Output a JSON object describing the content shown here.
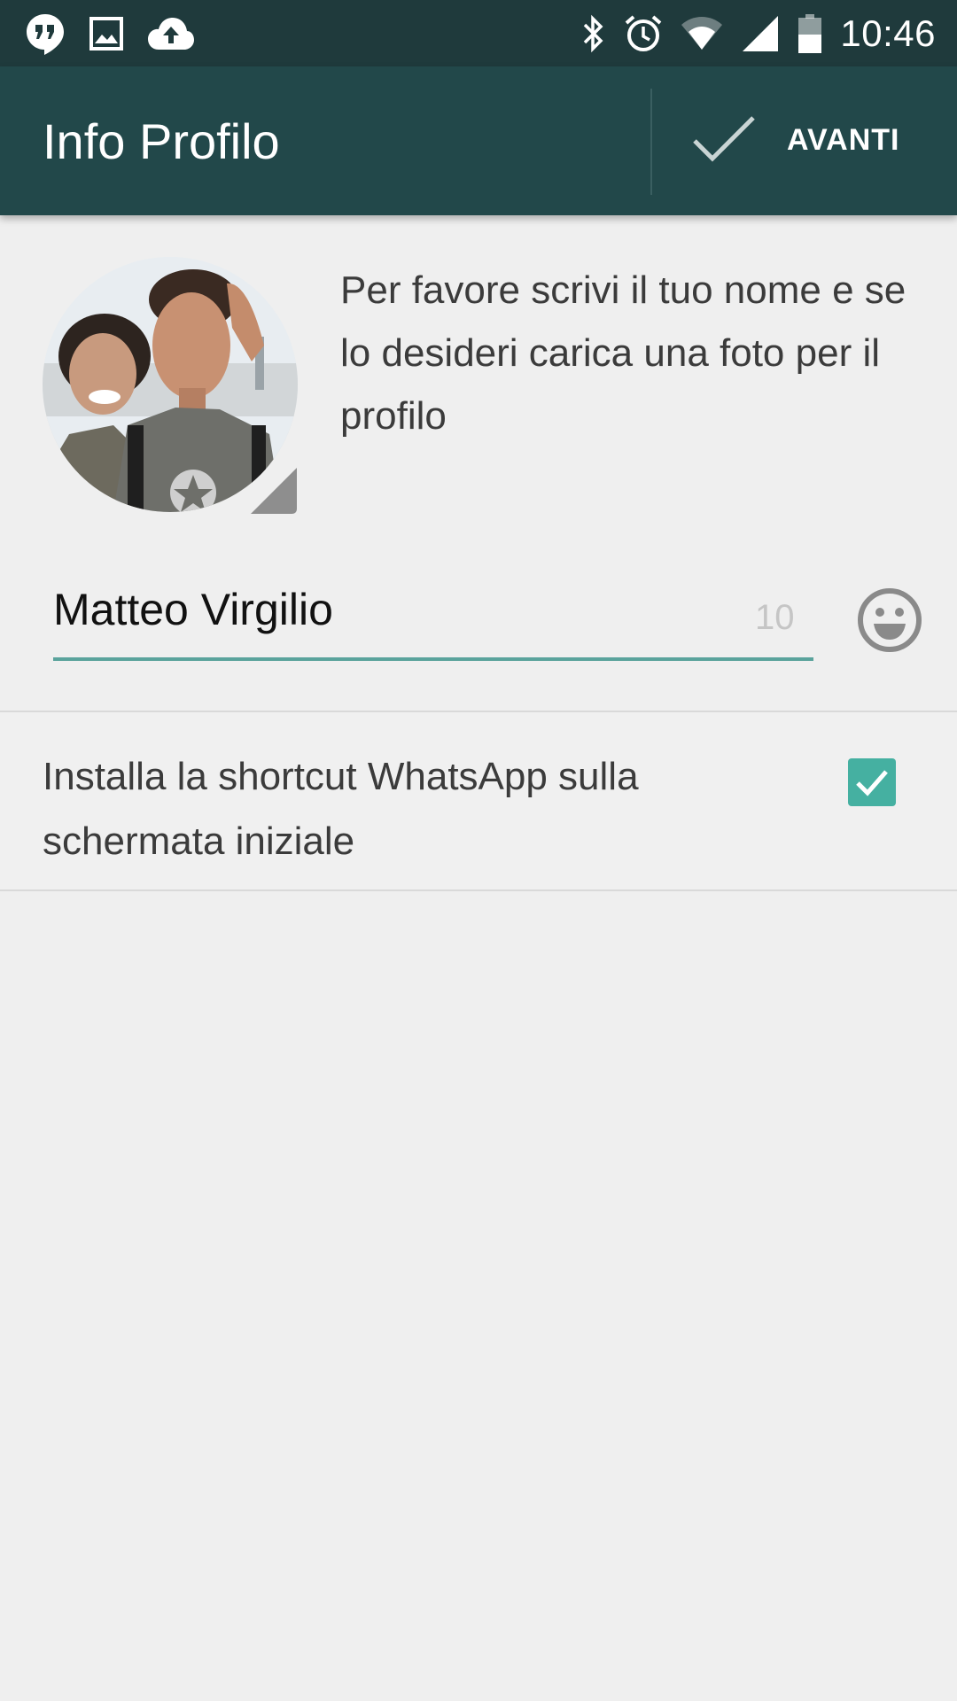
{
  "status_bar": {
    "time": "10:46",
    "left_icons": [
      "hangouts-icon",
      "image-icon",
      "cloud-upload-icon"
    ],
    "right_icons": [
      "bluetooth-icon",
      "alarm-icon",
      "wifi-icon",
      "signal-icon",
      "battery-icon"
    ]
  },
  "app_bar": {
    "title": "Info Profilo",
    "next_label": "AVANTI",
    "next_icon": "checkmark-icon"
  },
  "profile": {
    "intro_text": "Per favore scrivi il tuo nome e se lo desideri carica una foto per il profilo",
    "avatar_icon": "profile-photo"
  },
  "name_field": {
    "value": "Matteo Virgilio",
    "remaining_chars": "10",
    "emoji_icon": "smiley-icon"
  },
  "shortcut": {
    "label": "Installa la shortcut WhatsApp sulla schermata iniziale",
    "checked": true
  },
  "colors": {
    "status_bar": "#1f3a3c",
    "app_bar": "#22484a",
    "accent": "#45b0a1",
    "underline": "#5aa39c",
    "background": "#efefef"
  }
}
